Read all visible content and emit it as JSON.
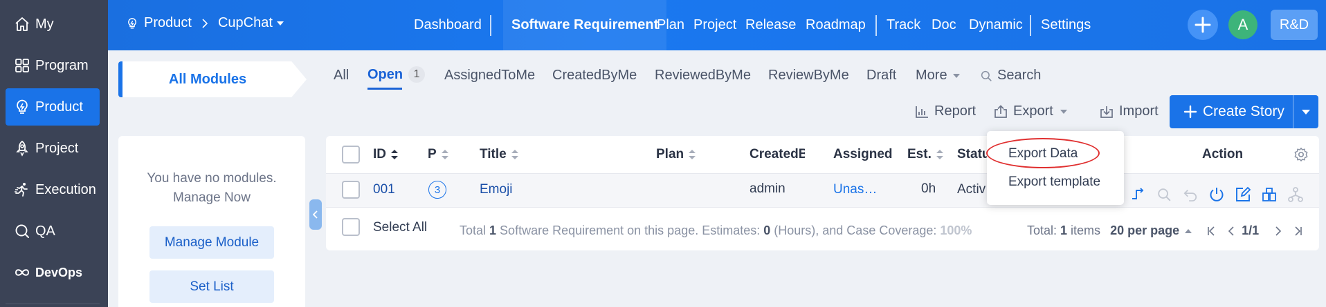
{
  "sidebar": {
    "items": [
      {
        "label": "My",
        "icon": "home-icon"
      },
      {
        "label": "Program",
        "icon": "grid-icon"
      },
      {
        "label": "Product",
        "icon": "lightbulb-icon"
      },
      {
        "label": "Project",
        "icon": "rocket-icon"
      },
      {
        "label": "Execution",
        "icon": "runner-icon"
      },
      {
        "label": "QA",
        "icon": "search-icon"
      },
      {
        "label": "DevOps",
        "icon": "infinity-icon"
      }
    ],
    "active": "Product"
  },
  "header": {
    "crumb_root": "Product",
    "crumb_current": "CupChat",
    "nav": [
      "Dashboard",
      "Software Requirement",
      "Plan",
      "Project",
      "Release",
      "Roadmap",
      "Track",
      "Doc",
      "Dynamic",
      "Settings"
    ],
    "active_nav": "Software Requirement",
    "avatar_letter": "A",
    "team_label": "R&D"
  },
  "modules": {
    "tab_label": "All Modules",
    "empty_line1": "You have no modules.",
    "empty_line2": "Manage Now",
    "manage_button": "Manage Module",
    "set_list_button": "Set List"
  },
  "filters": {
    "all": "All",
    "open": "Open",
    "open_count": "1",
    "assigned_to_me": "AssignedToMe",
    "created_by_me": "CreatedByMe",
    "reviewed_by_me": "ReviewedByMe",
    "review_by_me": "ReviewByMe",
    "draft": "Draft",
    "more": "More",
    "search": "Search"
  },
  "toolbar": {
    "report": "Report",
    "export": "Export",
    "import": "Import",
    "create_story": "Create Story"
  },
  "export_menu": {
    "export_data": "Export Data",
    "export_template": "Export template"
  },
  "table": {
    "columns": {
      "id": "ID",
      "priority": "P",
      "title": "Title",
      "plan": "Plan",
      "created_by": "CreatedB",
      "assigned_to": "Assigned",
      "estimate": "Est.",
      "status": "Status",
      "action": "Action"
    },
    "rows": [
      {
        "id": "001",
        "priority": "3",
        "title": "Emoji",
        "plan": "",
        "created_by": "admin",
        "assigned_to": "Unas…",
        "estimate": "0h",
        "status": "Activ"
      }
    ],
    "footer": {
      "select_all": "Select All",
      "summary_prefix": "Total",
      "summary_count": "1",
      "summary_mid": "Software Requirement on this page. Estimates:",
      "summary_est": "0",
      "summary_hours": "(Hours), and Case Coverage:",
      "summary_cov": "100%",
      "total_label": "Total:",
      "total_count": "1",
      "total_unit": "items",
      "per_page": "20 per page",
      "page_info": "1/1"
    }
  },
  "colors": {
    "accent": "#1a73e8",
    "sidebar_bg": "#3b4356",
    "highlight": "#e03030"
  }
}
